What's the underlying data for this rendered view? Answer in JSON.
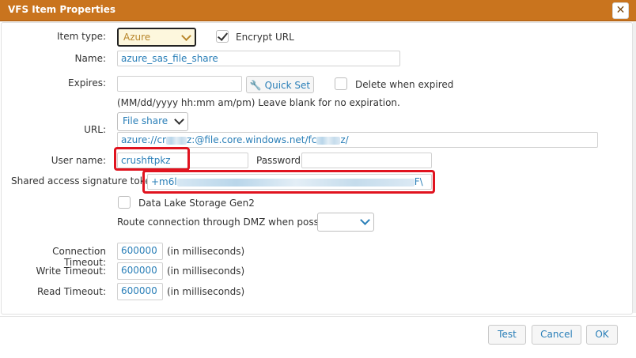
{
  "dialog": {
    "title": "VFS Item Properties",
    "close_glyph": "✕"
  },
  "fields": {
    "item_type": {
      "label": "Item type:",
      "value": "Azure"
    },
    "encrypt_url": {
      "label": "Encrypt URL",
      "checked": true
    },
    "name": {
      "label": "Name:",
      "value": "azure_sas_file_share"
    },
    "expires": {
      "label": "Expires:",
      "value": "",
      "quick_set": "Quick Set",
      "hint": "(MM/dd/yyyy hh:mm am/pm) Leave blank for no expiration."
    },
    "delete_when_expired": {
      "label": "Delete when expired",
      "checked": false
    },
    "url": {
      "label": "URL:",
      "share_type": "File share",
      "value_start": "azure://cr",
      "value_mid": "z:@file.core.windows.net/fc",
      "value_end": "z/"
    },
    "user_name": {
      "label": "User name:",
      "value": "crushftpkz"
    },
    "password": {
      "label": "Password:",
      "value": ""
    },
    "sas_token": {
      "label": "Shared access signature token",
      "value_start": "+m6l",
      "value_end": "F\\"
    },
    "data_lake": {
      "label": "Data Lake Storage Gen2",
      "checked": false
    },
    "route_dmz": {
      "label": "Route connection through DMZ when possible:",
      "value": ""
    },
    "timeouts": [
      {
        "label": "Connection Timeout:",
        "value": "600000",
        "unit": "(in milliseconds)"
      },
      {
        "label": "Write Timeout:",
        "value": "600000",
        "unit": "(in milliseconds)"
      },
      {
        "label": "Read Timeout:",
        "value": "600000",
        "unit": "(in milliseconds)"
      }
    ]
  },
  "buttons": {
    "test": "Test",
    "cancel": "Cancel",
    "ok": "OK"
  },
  "colors": {
    "title_bar": "#c9741e",
    "highlight": "#e0131f",
    "link_text": "#2a7fb8"
  }
}
